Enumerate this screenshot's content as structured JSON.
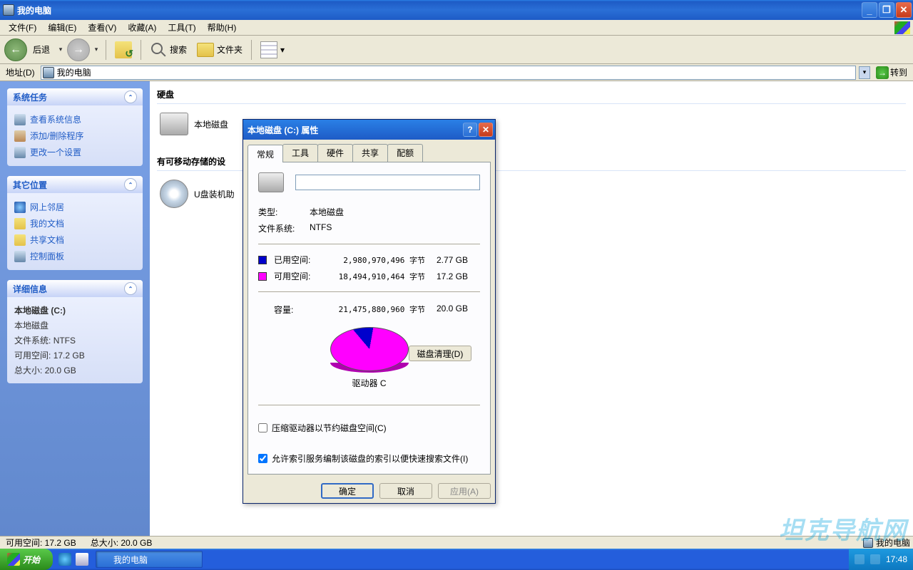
{
  "window": {
    "title": "我的电脑"
  },
  "menu": {
    "file": "文件(F)",
    "edit": "编辑(E)",
    "view": "查看(V)",
    "favorites": "收藏(A)",
    "tools": "工具(T)",
    "help": "帮助(H)"
  },
  "toolbar": {
    "back": "后退",
    "search": "搜索",
    "folders": "文件夹"
  },
  "addressbar": {
    "label": "地址(D)",
    "value": "我的电脑",
    "go": "转到"
  },
  "sidebar": {
    "tasks": {
      "title": "系统任务",
      "items": [
        "查看系统信息",
        "添加/删除程序",
        "更改一个设置"
      ]
    },
    "other": {
      "title": "其它位置",
      "items": [
        "网上邻居",
        "我的文档",
        "共享文档",
        "控制面板"
      ]
    },
    "details": {
      "title": "详细信息",
      "name": "本地磁盘 (C:)",
      "type": "本地磁盘",
      "fs_label": "文件系统:",
      "fs_value": "NTFS",
      "free_label": "可用空间:",
      "free_value": "17.2 GB",
      "total_label": "总大小:",
      "total_value": "20.0 GB"
    }
  },
  "content": {
    "group_drives": "硬盘",
    "drive_c": "本地磁盘",
    "group_removable": "有可移动存储的设",
    "removable": "U盘装机助"
  },
  "dialog": {
    "title": "本地磁盘 (C:) 属性",
    "tabs": [
      "常规",
      "工具",
      "硬件",
      "共享",
      "配额"
    ],
    "volume_name": "",
    "type_label": "类型:",
    "type_value": "本地磁盘",
    "fs_label": "文件系统:",
    "fs_value": "NTFS",
    "used_label": "已用空间:",
    "used_bytes": "2,980,970,496 字节",
    "used_gb": "2.77 GB",
    "free_label": "可用空间:",
    "free_bytes": "18,494,910,464 字节",
    "free_gb": "17.2 GB",
    "capacity_label": "容量:",
    "capacity_bytes": "21,475,880,960 字节",
    "capacity_gb": "20.0 GB",
    "drive_caption": "驱动器 C",
    "cleanup": "磁盘清理(D)",
    "compress": "压缩驱动器以节约磁盘空间(C)",
    "index": "允许索引服务编制该磁盘的索引以便快速搜索文件(I)",
    "ok": "确定",
    "cancel": "取消",
    "apply": "应用(A)"
  },
  "chart_data": {
    "type": "pie",
    "title": "驱动器 C",
    "series": [
      {
        "name": "已用空间",
        "value_bytes": 2980970496,
        "value_gb": 2.77,
        "color": "#0000cc"
      },
      {
        "name": "可用空间",
        "value_bytes": 18494910464,
        "value_gb": 17.2,
        "color": "#ff00ff"
      }
    ],
    "total_bytes": 21475880960,
    "total_gb": 20.0
  },
  "statusbar": {
    "free": "可用空间: 17.2 GB",
    "total": "总大小: 20.0 GB",
    "location": "我的电脑"
  },
  "taskbar": {
    "start": "开始",
    "task": "我的电脑",
    "time": "17:48"
  },
  "watermark": "坦克导航网"
}
